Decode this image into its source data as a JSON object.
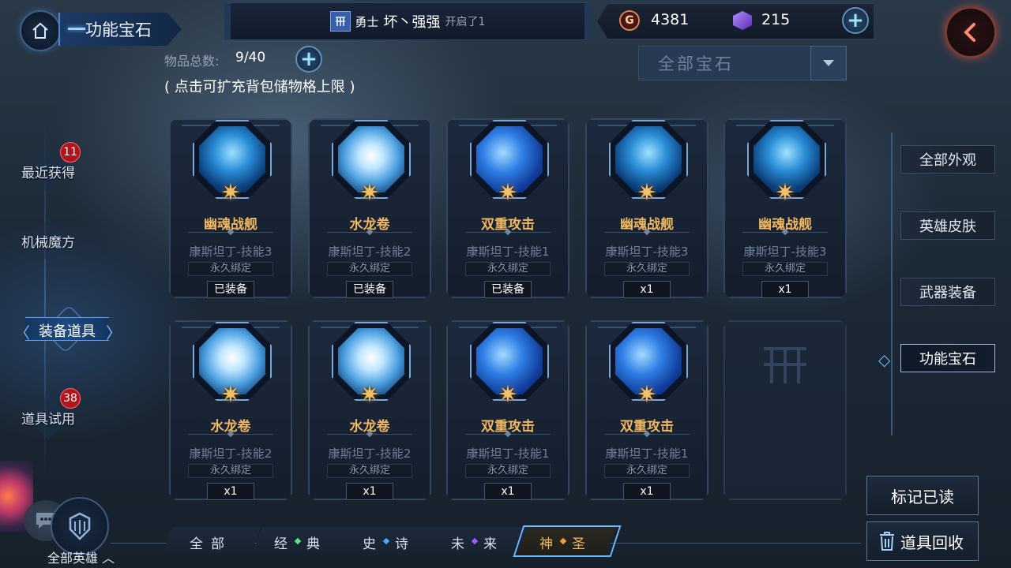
{
  "header": {
    "title": "功能宝石",
    "broadcast": {
      "prefix": "勇士",
      "name": "坏丶强强",
      "message": "开启了1"
    },
    "currency": {
      "gold": "4381",
      "gold_symbol": "G",
      "gems": "215"
    }
  },
  "inventory": {
    "count_label": "物品总数:",
    "count_value": "9/40",
    "expand_hint": "( 点击可扩充背包储物格上限 )"
  },
  "filter": {
    "selected": "全部宝石"
  },
  "left_nav": {
    "items": [
      {
        "label": "最近获得",
        "badge": "11"
      },
      {
        "label": "机械魔方"
      },
      {
        "label": "装备道具",
        "active": true
      },
      {
        "label": "道具试用",
        "badge": "38"
      }
    ]
  },
  "items": [
    {
      "name": "幽魂战舰",
      "skill": "康斯坦丁-技能3",
      "bind": "永久绑定",
      "status": "已装备",
      "art": "ship"
    },
    {
      "name": "水龙卷",
      "skill": "康斯坦丁-技能2",
      "bind": "永久绑定",
      "status": "已装备",
      "art": "tornado"
    },
    {
      "name": "双重攻击",
      "skill": "康斯坦丁-技能1",
      "bind": "永久绑定",
      "status": "已装备",
      "art": "double"
    },
    {
      "name": "幽魂战舰",
      "skill": "康斯坦丁-技能3",
      "bind": "永久绑定",
      "status": "x1",
      "art": "ship"
    },
    {
      "name": "幽魂战舰",
      "skill": "康斯坦丁-技能3",
      "bind": "永久绑定",
      "status": "x1",
      "art": "ship"
    },
    {
      "name": "水龙卷",
      "skill": "康斯坦丁-技能2",
      "bind": "永久绑定",
      "status": "x1",
      "art": "tornado"
    },
    {
      "name": "水龙卷",
      "skill": "康斯坦丁-技能2",
      "bind": "永久绑定",
      "status": "x1",
      "art": "tornado"
    },
    {
      "name": "双重攻击",
      "skill": "康斯坦丁-技能1",
      "bind": "永久绑定",
      "status": "x1",
      "art": "double"
    },
    {
      "name": "双重攻击",
      "skill": "康斯坦丁-技能1",
      "bind": "永久绑定",
      "status": "x1",
      "art": "double"
    }
  ],
  "categories": [
    {
      "label": "全部外观"
    },
    {
      "label": "英雄皮肤"
    },
    {
      "label": "武器装备"
    },
    {
      "label": "功能宝石",
      "active": true
    }
  ],
  "actions": {
    "mark_read": "标记已读",
    "recycle": "道具回收"
  },
  "rarity_tabs": [
    {
      "label": "全部"
    },
    {
      "label": "经典",
      "dot_color": "#5fe08a"
    },
    {
      "label": "史诗",
      "dot_color": "#4aa8ff"
    },
    {
      "label": "未来",
      "dot_color": "#9b5cff"
    },
    {
      "label": "神圣",
      "dot_color": "#f0a040",
      "active": true
    }
  ],
  "hero_filter": {
    "label": "全部英雄"
  },
  "colors": {
    "accent": "#6fb8ff",
    "item_name": "#f0b761",
    "badge": "#b0141c"
  }
}
